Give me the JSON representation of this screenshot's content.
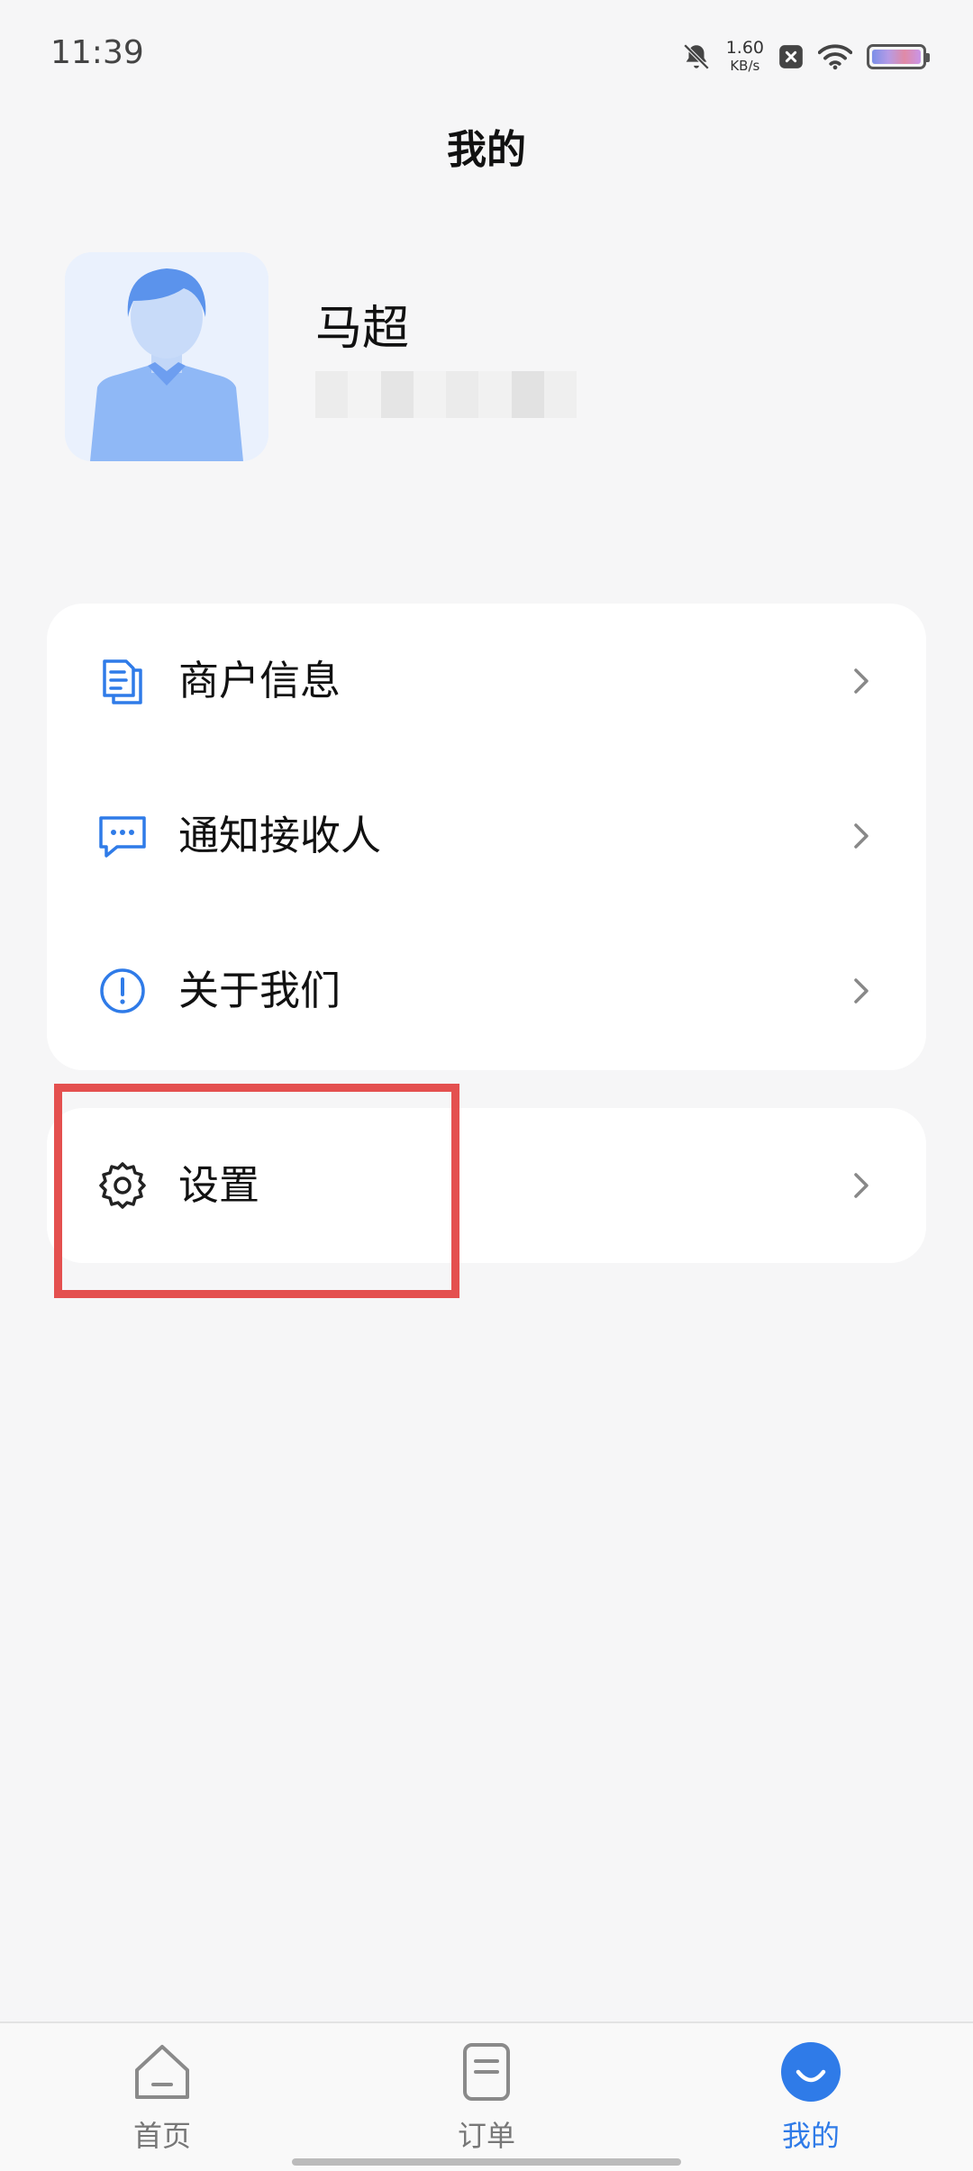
{
  "status_bar": {
    "time": "11:39",
    "net_speed": "1.60",
    "net_unit": "KB/s",
    "icons": [
      "bell-muted-icon",
      "close-box-icon",
      "wifi-icon",
      "battery-icon"
    ]
  },
  "header": {
    "title": "我的"
  },
  "profile": {
    "name": "马超",
    "avatar_icon": "user-avatar-icon"
  },
  "menu": {
    "items": [
      {
        "label": "商户信息",
        "icon": "document-icon"
      },
      {
        "label": "通知接收人",
        "icon": "chat-bubble-icon"
      },
      {
        "label": "关于我们",
        "icon": "info-circle-icon"
      }
    ],
    "settings": {
      "label": "设置",
      "icon": "gear-icon"
    }
  },
  "tabbar": {
    "tabs": [
      {
        "label": "首页",
        "icon": "home-icon",
        "active": false
      },
      {
        "label": "订单",
        "icon": "order-icon",
        "active": false
      },
      {
        "label": "我的",
        "icon": "profile-smile-icon",
        "active": true
      }
    ]
  },
  "colors": {
    "accent": "#2f7be8",
    "icon_blue": "#2f7be8",
    "highlight_border": "#e4504f",
    "background": "#f6f6f7"
  }
}
